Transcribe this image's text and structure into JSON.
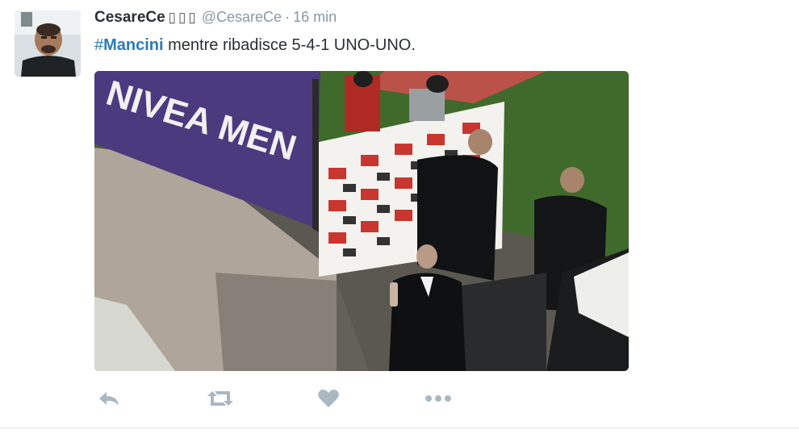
{
  "tweet": {
    "fullname": "CesareCe",
    "emoji": "▯▯▯",
    "screen_name": "@CesareCe",
    "separator": "·",
    "time": "16 min",
    "hashtag": "Mancini",
    "text_rest": " mentre ribadisce 5-4-1 UNO-UNO."
  },
  "media": {
    "banner_text": "NIVEA MEN"
  },
  "icons": {
    "reply": "reply-icon",
    "retweet": "retweet-icon",
    "like": "heart-icon",
    "more": "more-dots-icon"
  },
  "colors": {
    "link": "#2b7bb9",
    "action_icons": "#aab8c2",
    "meta_text": "#8899a6"
  }
}
